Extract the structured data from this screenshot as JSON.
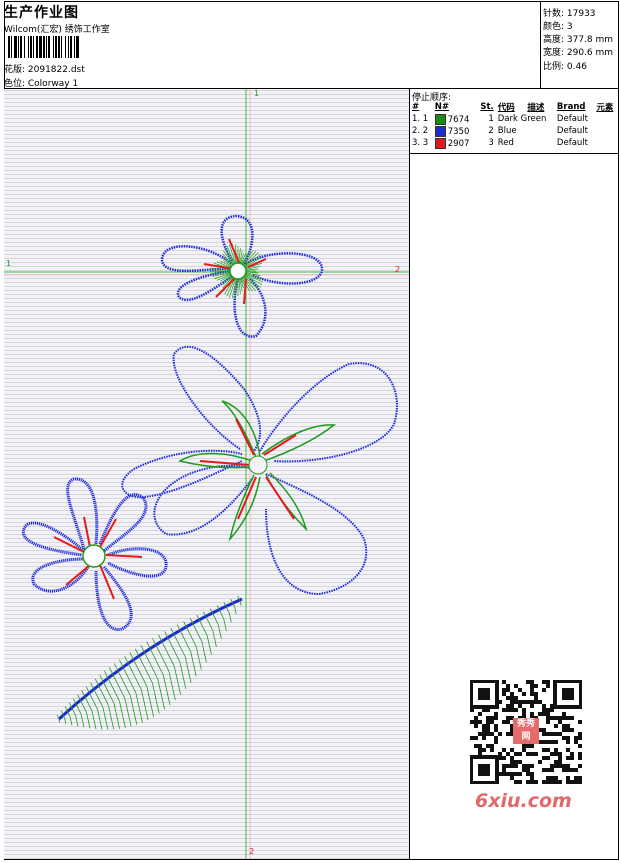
{
  "header": {
    "title": "生产作业图",
    "company": "Wilcom(汇宏) 绣饰工作室",
    "design_label": "花版: 2091822.dst",
    "colorway_label": "色位: Colorway 1"
  },
  "stats": {
    "stitches": "针数: 17933",
    "colors": "颜色: 3",
    "height": "高度: 377.8 mm",
    "width": "宽度: 290.6 mm",
    "scale": "比例: 0.46"
  },
  "stop_sequence": {
    "title": "停止顺序:",
    "columns": [
      "#",
      "N#",
      "St.",
      "代码",
      "描述",
      "Brand",
      "元素"
    ],
    "rows": [
      {
        "index": "1. 1",
        "code": "7674",
        "st": "1",
        "desc": "Dark Green",
        "brand": "Default",
        "color": "#1a8a1a"
      },
      {
        "index": "2. 2",
        "code": "7350",
        "st": "2",
        "desc": "Blue",
        "brand": "Default",
        "color": "#1e2ccf"
      },
      {
        "index": "3. 3",
        "code": "2907",
        "st": "3",
        "desc": "Red",
        "brand": "Default",
        "color": "#e01818"
      }
    ]
  },
  "markers": {
    "h_left": "1",
    "h_right": "2",
    "v_top": "1",
    "v_bottom": "2"
  },
  "watermark": "6xiu.com",
  "qr_badge": "秀秀网",
  "colors": {
    "green": "#1f9a1f",
    "blue": "#1c2ad6",
    "red": "#e41b1b",
    "guide": "#3bbf3b"
  }
}
